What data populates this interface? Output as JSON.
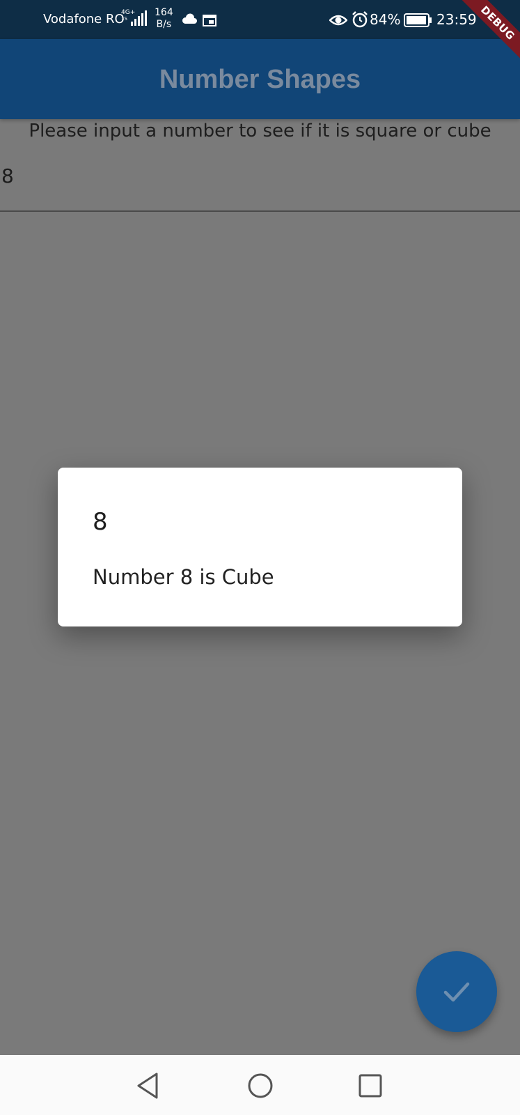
{
  "status_bar": {
    "carrier": "Vodafone RO",
    "network_type": "4G+",
    "network_sub": "1S",
    "speed_value": "164",
    "speed_unit": "B/s",
    "battery_percent": "84%",
    "time": "23:59",
    "icons": [
      "signal-icon",
      "cloud-icon",
      "calendar-icon",
      "eye-icon",
      "alarm-icon",
      "battery-icon"
    ],
    "background": "#0e2d46"
  },
  "debug_banner": {
    "label": "DEBUG",
    "color": "#7c1a22"
  },
  "app_bar": {
    "title": "Number Shapes",
    "background": "#114577"
  },
  "main": {
    "prompt": "Please input a number to see if it is square or cube",
    "input_value": "8"
  },
  "dialog": {
    "title": "8",
    "content": "Number 8 is Cube"
  },
  "fab": {
    "icon": "check-icon",
    "color": "#1a5a96"
  },
  "nav_bar": {
    "buttons": [
      "back-icon",
      "home-icon",
      "recents-icon"
    ]
  },
  "scrim_color": "#7a7a7a"
}
